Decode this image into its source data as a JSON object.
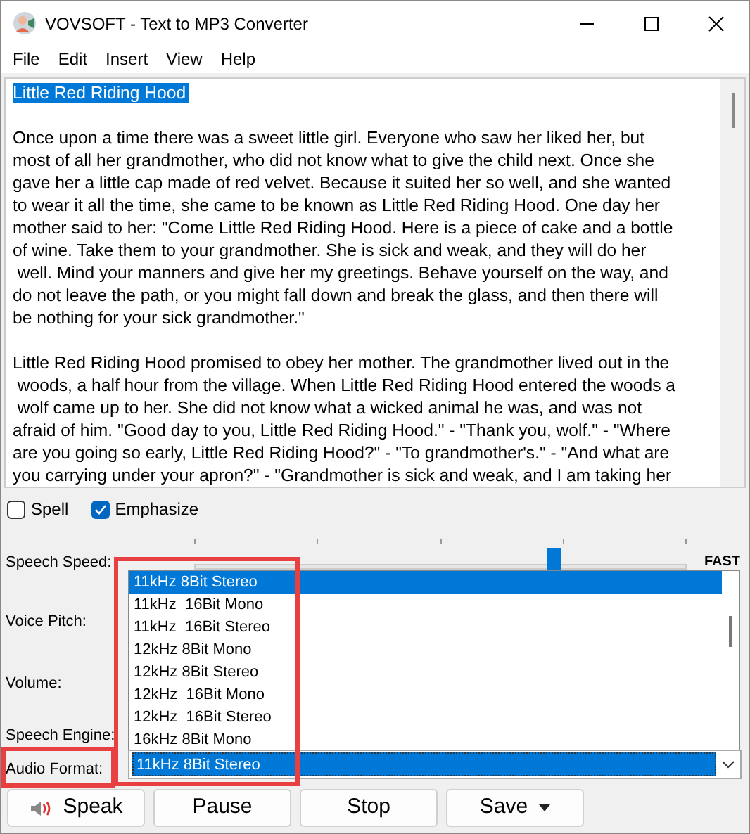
{
  "window": {
    "title": "VOVSOFT - Text to MP3 Converter"
  },
  "menu": [
    "File",
    "Edit",
    "Insert",
    "View",
    "Help"
  ],
  "editor": {
    "selected_title": "Little Red Riding Hood",
    "paragraphs": [
      [
        "Once upon a time there was a sweet little girl. Everyone who saw her liked her, but",
        "most of all her grandmother, who did not know what to give the child next. Once she",
        "gave her a little cap made of red velvet. Because it suited her so well, and she wanted",
        "to wear it all the time, she came to be known as Little Red Riding Hood. One day her",
        "mother said to her: \"Come Little Red Riding Hood. Here is a piece of cake and a bottle",
        "of wine. Take them to your grandmother. She is sick and weak, and they will do her",
        " well. Mind your manners and give her my greetings. Behave yourself on the way, and",
        "do not leave the path, or you might fall down and break the glass, and then there will",
        "be nothing for your sick grandmother.\""
      ],
      [
        "Little Red Riding Hood promised to obey her mother. The grandmother lived out in the",
        " woods, a half hour from the village. When Little Red Riding Hood entered the woods a",
        " wolf came up to her. She did not know what a wicked animal he was, and was not",
        "afraid of him. \"Good day to you, Little Red Riding Hood.\" - \"Thank you, wolf.\" - \"Where",
        "are you going so early, Little Red Riding Hood?\" - \"To grandmother's.\" - \"And what are",
        "you carrying under your apron?\" - \"Grandmother is sick and weak, and I am taking her"
      ]
    ]
  },
  "options": [
    {
      "label": "Spell",
      "checked": false
    },
    {
      "label": "Emphasize",
      "checked": true
    }
  ],
  "settings": {
    "labels": [
      "Speech Speed:",
      "Voice Pitch:",
      "Volume:",
      "Speech Engine:",
      "Audio Format:"
    ],
    "speed": {
      "max_label": "FAST",
      "level": 0.73
    }
  },
  "audio_format": {
    "value": "11kHz 8Bit Stereo",
    "options": [
      {
        "label": "11kHz 8Bit Stereo",
        "selected": true
      },
      {
        "label": "11kHz  16Bit Mono",
        "selected": false
      },
      {
        "label": "11kHz  16Bit Stereo",
        "selected": false
      },
      {
        "label": "12kHz 8Bit Mono",
        "selected": false
      },
      {
        "label": "12kHz 8Bit Stereo",
        "selected": false
      },
      {
        "label": "12kHz  16Bit Mono",
        "selected": false
      },
      {
        "label": "12kHz  16Bit Stereo",
        "selected": false
      },
      {
        "label": "16kHz 8Bit Mono",
        "selected": false
      }
    ]
  },
  "buttons": [
    {
      "label": "Speak",
      "kind": "speak"
    },
    {
      "label": "Pause",
      "kind": "plain"
    },
    {
      "label": "Stop",
      "kind": "plain"
    },
    {
      "label": "Save",
      "kind": "split"
    }
  ]
}
